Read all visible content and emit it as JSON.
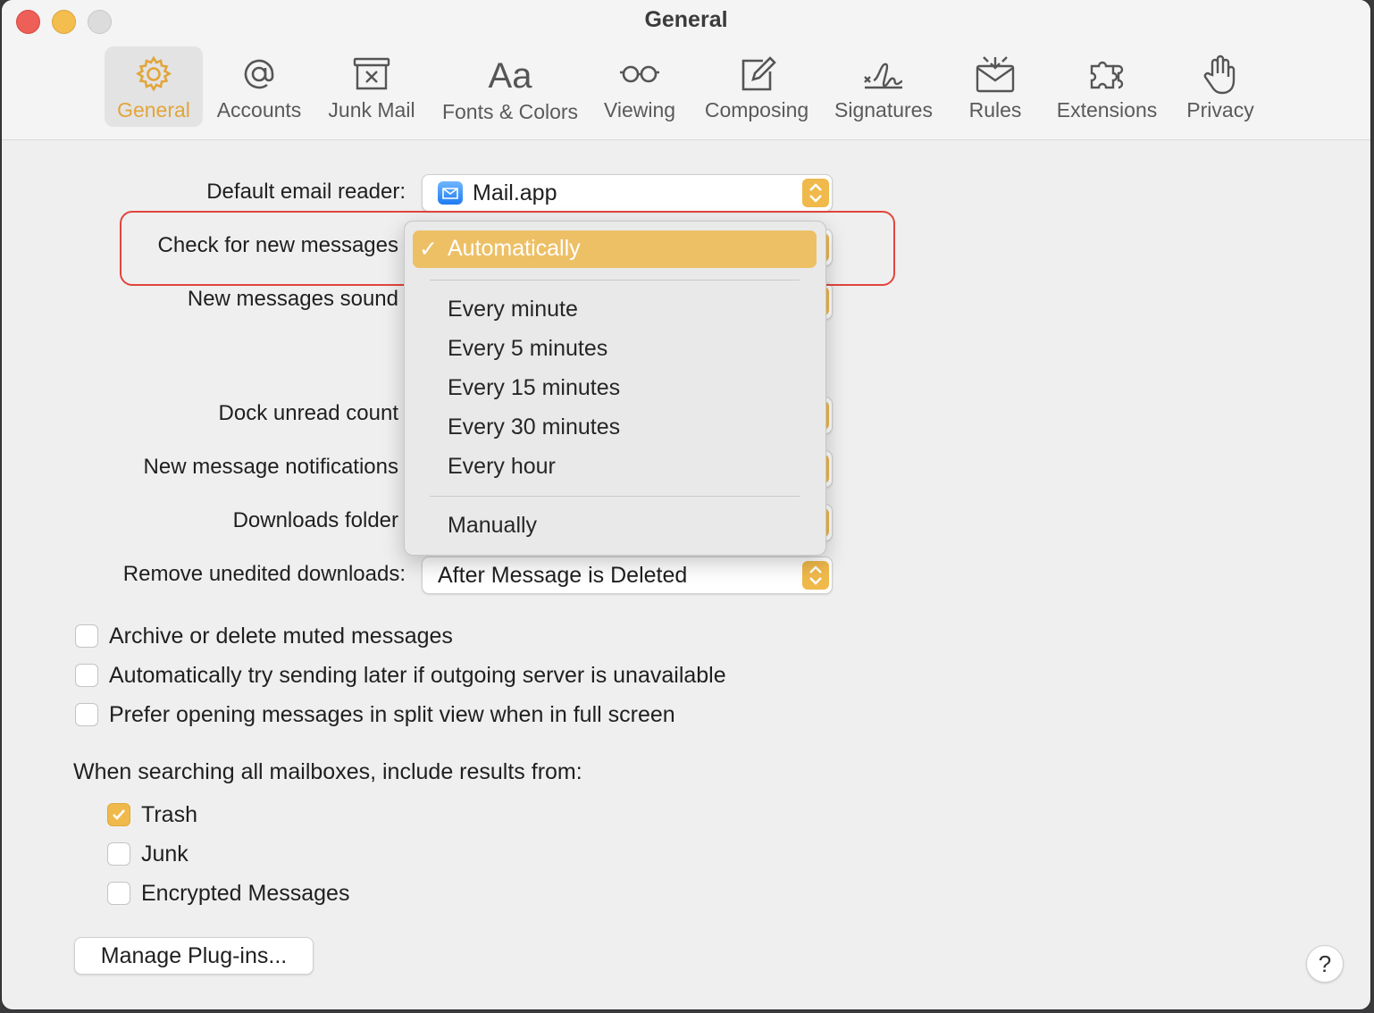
{
  "window": {
    "title": "General"
  },
  "tabs": [
    {
      "label": "General",
      "icon": "gear-icon",
      "active": true
    },
    {
      "label": "Accounts",
      "icon": "at-sign-icon"
    },
    {
      "label": "Junk Mail",
      "icon": "junk-mail-icon"
    },
    {
      "label": "Fonts & Colors",
      "icon": "fonts-icon",
      "glyph": "Aa"
    },
    {
      "label": "Viewing",
      "icon": "glasses-icon"
    },
    {
      "label": "Composing",
      "icon": "compose-icon"
    },
    {
      "label": "Signatures",
      "icon": "signature-icon"
    },
    {
      "label": "Rules",
      "icon": "rules-icon"
    },
    {
      "label": "Extensions",
      "icon": "puzzle-icon"
    },
    {
      "label": "Privacy",
      "icon": "hand-icon"
    }
  ],
  "settings": {
    "default_reader": {
      "label": "Default email reader:",
      "value": "Mail.app"
    },
    "check_messages": {
      "label": "Check for new messages"
    },
    "new_sound": {
      "label": "New messages sound"
    },
    "dock_count": {
      "label": "Dock unread count"
    },
    "notifications": {
      "label": "New message notifications"
    },
    "downloads_folder": {
      "label": "Downloads folder"
    },
    "remove_downloads": {
      "label": "Remove unedited downloads:",
      "value": "After Message is Deleted"
    }
  },
  "dropdown": {
    "selected": "Automatically",
    "check_glyph": "✓",
    "options": [
      "Every minute",
      "Every 5 minutes",
      "Every 15 minutes",
      "Every 30 minutes",
      "Every hour"
    ],
    "last": "Manually"
  },
  "checkboxes": [
    {
      "label": "Archive or delete muted messages",
      "checked": false
    },
    {
      "label": "Automatically try sending later if outgoing server is unavailable",
      "checked": false
    },
    {
      "label": "Prefer opening messages in split view when in full screen",
      "checked": false
    }
  ],
  "search": {
    "heading": "When searching all mailboxes, include results from:",
    "items": [
      {
        "label": "Trash",
        "checked": true
      },
      {
        "label": "Junk",
        "checked": false
      },
      {
        "label": "Encrypted Messages",
        "checked": false
      }
    ]
  },
  "buttons": {
    "manage_plugins": "Manage Plug-ins...",
    "help": "?"
  },
  "colors": {
    "accent": "#f0b94b",
    "menu_highlight": "#edc066",
    "annotation": "#e2453c"
  }
}
